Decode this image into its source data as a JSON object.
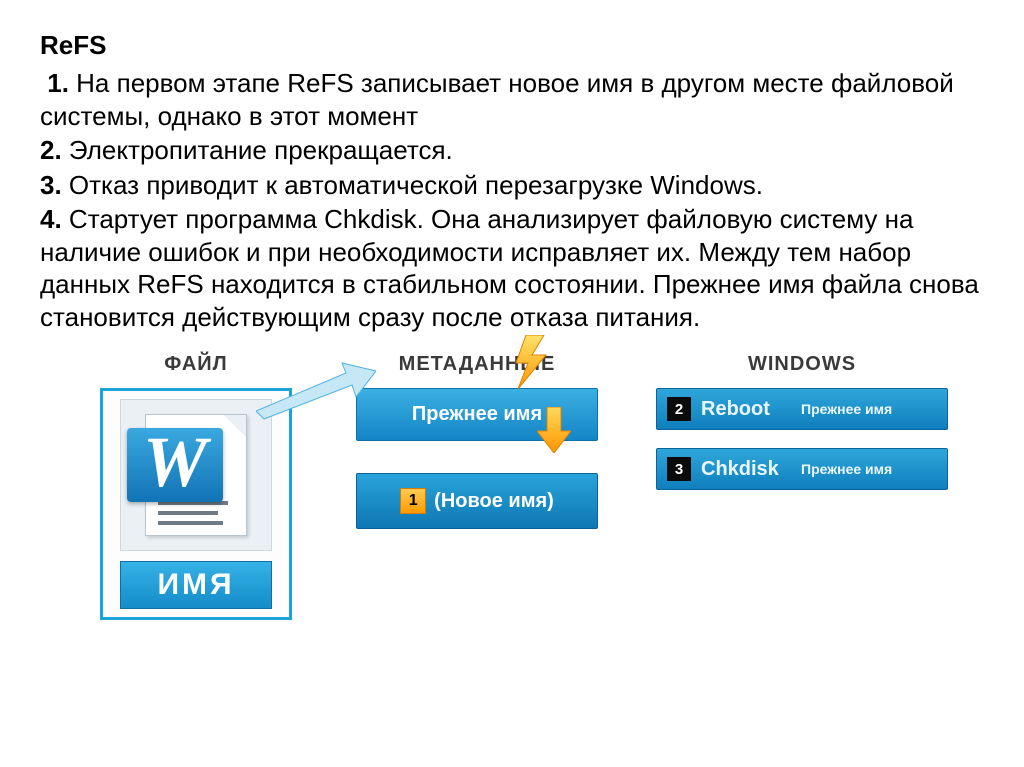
{
  "title": "ReFS",
  "list": {
    "i1_num": "1.",
    "i1": "На первом этапе ReFS записывает новое имя в другом месте файловой системы, однако в этот момент",
    "i2_num": "2.",
    "i2": "Электропитание прекращается.",
    "i3_num": "3.",
    "i3": "Отказ приводит к автоматической перезагрузке Windows.",
    "i4_num": "4.",
    "i4": "Стартует программа Chkdisk. Она анализирует файловую систему на наличие ошибок и при необходимости исправляет их. Между тем набор данных ReFS находится в стабильном состоянии. Прежнее имя файла снова становится действующим сразу после отказа питания."
  },
  "diagram": {
    "file_header": "ФАЙЛ",
    "meta_header": "МЕТАДАННЫЕ",
    "win_header": "WINDOWS",
    "word_icon_letter": "W",
    "name_box": "ИМЯ",
    "prev_name": "Прежнее имя",
    "new_name_num": "1",
    "new_name": "(Новое имя)",
    "win1_num": "2",
    "win1_action": "Reboot",
    "win1_right": "Прежнее имя",
    "win2_num": "3",
    "win2_action": "Chkdisk",
    "win2_right": "Прежнее имя"
  },
  "colors": {
    "accent_blue": "#1aa3d8",
    "orange": "#ff9a00"
  }
}
